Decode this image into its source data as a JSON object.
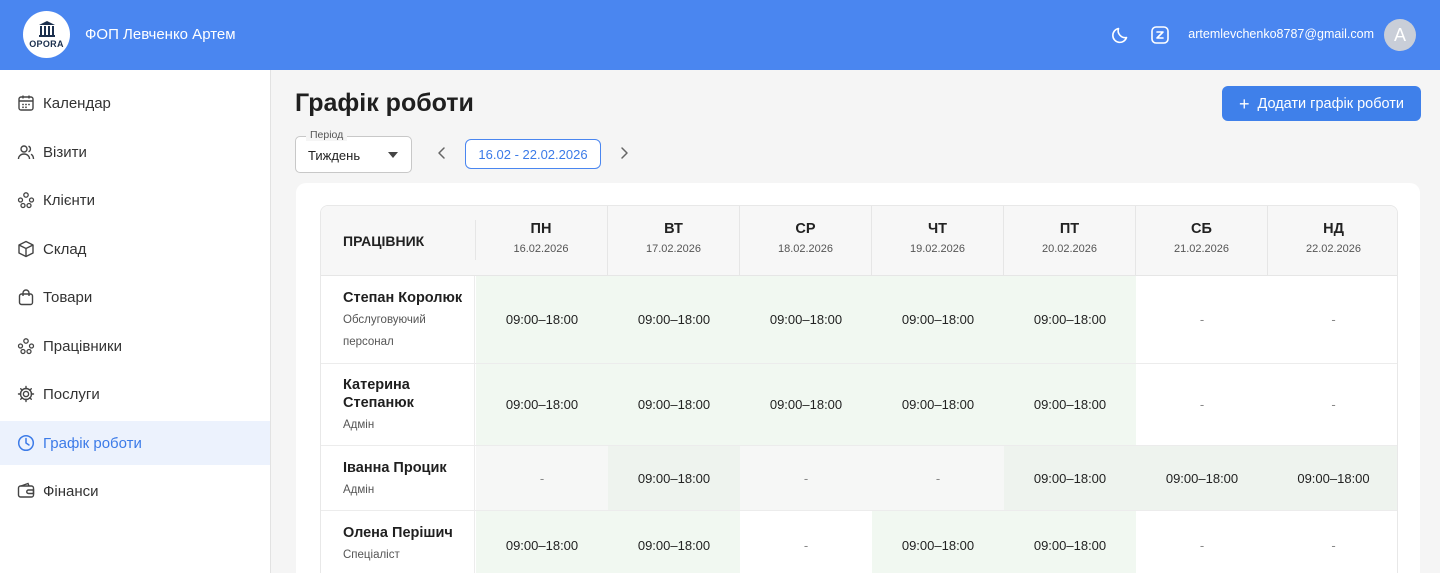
{
  "header": {
    "logo_text": "OPORA",
    "company": "ФОП Левченко Артем",
    "email": "artemlevchenko8787@gmail.com",
    "avatar_letter": "A",
    "icons": [
      "moon-icon",
      "translate-icon"
    ]
  },
  "sidebar": {
    "items": [
      {
        "label": "Календар",
        "icon": "calendar-icon"
      },
      {
        "label": "Візити",
        "icon": "users-icon"
      },
      {
        "label": "Клієнти",
        "icon": "clients-icon"
      },
      {
        "label": "Склад",
        "icon": "box-icon"
      },
      {
        "label": "Товари",
        "icon": "bag-icon"
      },
      {
        "label": "Працівники",
        "icon": "team-icon"
      },
      {
        "label": "Послуги",
        "icon": "gear-icon"
      },
      {
        "label": "Графік роботи",
        "icon": "clock-icon",
        "active": true
      },
      {
        "label": "Фінанси",
        "icon": "wallet-icon"
      }
    ]
  },
  "main": {
    "title": "Графік роботи",
    "add_button": "Додати графік роботи",
    "period": {
      "label": "Період",
      "value": "Тиждень"
    },
    "date_range": "16.02 - 22.02.2026"
  },
  "table": {
    "employee_header": "ПРАЦІВНИК",
    "days": [
      {
        "name": "ПН",
        "date": "16.02.2026"
      },
      {
        "name": "ВТ",
        "date": "17.02.2026"
      },
      {
        "name": "СР",
        "date": "18.02.2026"
      },
      {
        "name": "ЧТ",
        "date": "19.02.2026"
      },
      {
        "name": "ПТ",
        "date": "20.02.2026"
      },
      {
        "name": "СБ",
        "date": "21.02.2026"
      },
      {
        "name": "НД",
        "date": "22.02.2026"
      }
    ],
    "rows": [
      {
        "name": "Степан Королюк",
        "role": "Обслуговуючий персонал",
        "cells": [
          "09:00–18:00",
          "09:00–18:00",
          "09:00–18:00",
          "09:00–18:00",
          "09:00–18:00",
          "-",
          "-"
        ]
      },
      {
        "name": "Катерина Степанюк",
        "role": "Адмін",
        "cells": [
          "09:00–18:00",
          "09:00–18:00",
          "09:00–18:00",
          "09:00–18:00",
          "09:00–18:00",
          "-",
          "-"
        ]
      },
      {
        "name": "Іванна Процик",
        "role": "Адмін",
        "cells": [
          "-",
          "09:00–18:00",
          "-",
          "-",
          "09:00–18:00",
          "09:00–18:00",
          "09:00–18:00"
        ]
      },
      {
        "name": "Олена Перішич",
        "role": "Спеціаліст",
        "cells": [
          "09:00–18:00",
          "09:00–18:00",
          "-",
          "09:00–18:00",
          "09:00–18:00",
          "-",
          "-"
        ]
      }
    ]
  },
  "colors": {
    "accent": "#4a86f0",
    "working_cell": "#f1f8f1",
    "working_cell_alt": "#eef3ee",
    "off_cell_alt": "#f6f7f6"
  }
}
